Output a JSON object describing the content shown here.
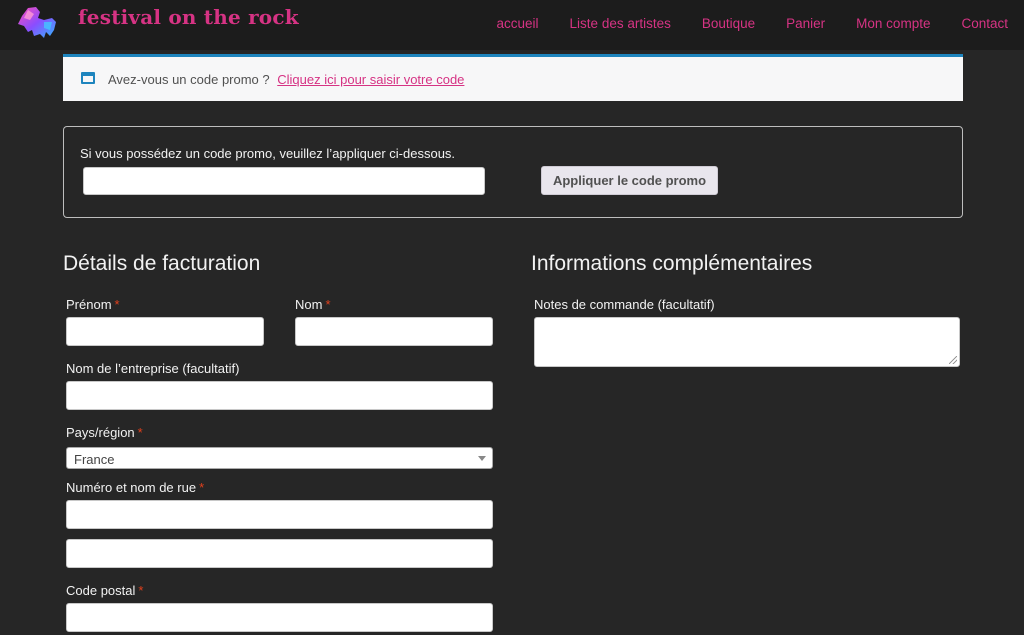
{
  "header": {
    "site_title": "festival on the rock",
    "logo_icon": "lion-logo-icon",
    "nav": [
      {
        "label": "accueil"
      },
      {
        "label": "Liste des artistes"
      },
      {
        "label": "Boutique"
      },
      {
        "label": "Panier"
      },
      {
        "label": "Mon compte"
      },
      {
        "label": "Contact"
      }
    ]
  },
  "colors": {
    "accent": "#d63384",
    "notice_border": "#1e85be",
    "required": "#e2401c",
    "background": "#262626"
  },
  "coupon_notice": {
    "icon": "window-icon",
    "text": "Avez-vous un code promo ?",
    "link": "Cliquez ici pour saisir votre code"
  },
  "coupon_form": {
    "label": "Si vous possédez un code promo, veuillez l’appliquer ci-dessous.",
    "input_value": "",
    "button": "Appliquer le code promo"
  },
  "billing": {
    "title": "Détails de facturation",
    "required_marker": "*",
    "first_name": {
      "label": "Prénom",
      "value": ""
    },
    "last_name": {
      "label": "Nom",
      "value": ""
    },
    "company": {
      "label": "Nom de l’entreprise (facultatif)",
      "value": ""
    },
    "country": {
      "label": "Pays/région",
      "value": "France"
    },
    "street": {
      "label": "Numéro et nom de rue",
      "value": "",
      "value2": ""
    },
    "postcode": {
      "label": "Code postal",
      "value": ""
    }
  },
  "additional": {
    "title": "Informations complémentaires",
    "notes": {
      "label": "Notes de commande (facultatif)",
      "value": ""
    }
  }
}
